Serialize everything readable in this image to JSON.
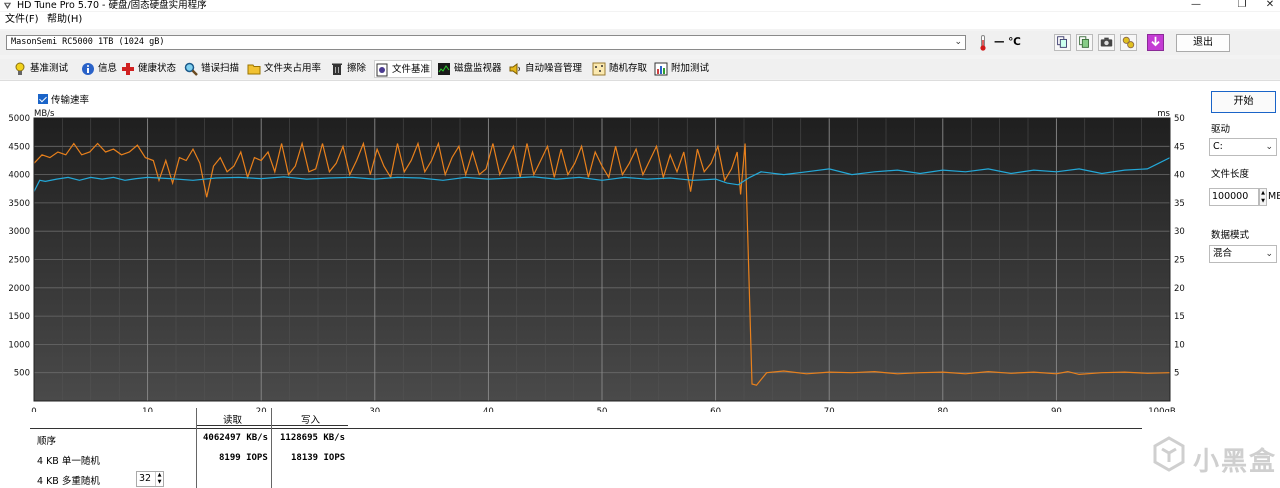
{
  "window": {
    "title": "HD Tune Pro 5.70 - 硬盘/固态硬盘实用程序"
  },
  "menu": [
    {
      "label": "文件(F)"
    },
    {
      "label": "帮助(H)"
    }
  ],
  "drive": {
    "name": "MasonSemi RC5000 1TB (1024 gB)",
    "temperature": "— ℃",
    "exit_label": "退出"
  },
  "tabs": [
    {
      "label": "基准测试",
      "icon": "bulb-icon"
    },
    {
      "label": "信息",
      "icon": "info-icon"
    },
    {
      "label": "健康状态",
      "icon": "health-cross-icon"
    },
    {
      "label": "错误扫描",
      "icon": "magnifier-icon"
    },
    {
      "label": "文件夹占用率",
      "icon": "folder-icon"
    },
    {
      "label": "擦除",
      "icon": "trash-icon"
    },
    {
      "label": "文件基准",
      "icon": "file-benchmark-icon"
    },
    {
      "label": "磁盘监视器",
      "icon": "monitor-icon"
    },
    {
      "label": "自动噪音管理",
      "icon": "speaker-icon"
    },
    {
      "label": "随机存取",
      "icon": "random-access-icon"
    },
    {
      "label": "附加测试",
      "icon": "extra-tests-icon"
    }
  ],
  "options": {
    "transfer_rate_label": "传输速率"
  },
  "side_panel": {
    "start_label": "开始",
    "drive_label": "驱动",
    "drive_value": "C:",
    "file_length_label": "文件长度",
    "file_length_value": "100000",
    "file_length_unit": "MB",
    "data_mode_label": "数据模式",
    "data_mode_value": "混合"
  },
  "results": {
    "col_read": "读取",
    "col_write": "写入",
    "rows": [
      {
        "label": "顺序",
        "read": "4062497 KB/s",
        "write": "1128695 KB/s"
      },
      {
        "label": "4 KB 单一随机",
        "read": "8199 IOPS",
        "write": "18139 IOPS"
      },
      {
        "label": "4 KB 多重随机",
        "read": "",
        "write": ""
      }
    ],
    "queue_depth": "32"
  },
  "watermark": {
    "text": "小黑盒"
  },
  "chart_data": {
    "type": "line",
    "ylabel": "MB/s",
    "y2label": "ms",
    "ylim": [
      0,
      5000
    ],
    "y2lim": [
      0,
      50
    ],
    "xlim": [
      0,
      100
    ],
    "x_unit": "gB",
    "y_ticks": [
      500,
      1000,
      1500,
      2000,
      2500,
      3000,
      3500,
      4000,
      4500,
      5000
    ],
    "y2_ticks": [
      5,
      10,
      15,
      20,
      25,
      30,
      35,
      40,
      45,
      50
    ],
    "x_ticks": [
      "0",
      "10",
      "20",
      "30",
      "40",
      "50",
      "60",
      "70",
      "80",
      "90",
      "100gB"
    ],
    "series": [
      {
        "color": "#e8801c",
        "x": [
          0,
          0.7,
          1.4,
          2.1,
          2.8,
          3.5,
          4.2,
          4.9,
          5.6,
          6.3,
          7,
          7.7,
          8.4,
          9.1,
          9.8,
          10.5,
          11,
          11.6,
          12.2,
          12.8,
          13.4,
          14,
          14.6,
          15.2,
          15.8,
          16.4,
          17,
          17.6,
          18.2,
          18.8,
          19.4,
          20,
          20.6,
          21.2,
          21.8,
          22.4,
          23,
          23.6,
          24.2,
          24.8,
          25.4,
          26,
          26.6,
          27.2,
          27.8,
          28.4,
          29,
          29.6,
          30.2,
          30.8,
          31.4,
          32,
          32.6,
          33.2,
          33.8,
          34.4,
          35,
          35.6,
          36.2,
          36.8,
          37.4,
          38,
          38.6,
          39.2,
          39.8,
          40.4,
          41,
          41.6,
          42.2,
          42.8,
          43.4,
          44,
          44.6,
          45.2,
          45.8,
          46.4,
          47,
          47.6,
          48.2,
          48.8,
          49.4,
          50,
          50.6,
          51.2,
          51.8,
          52.4,
          53,
          53.6,
          54.2,
          54.8,
          55.4,
          56,
          56.6,
          57.2,
          57.8,
          58.4,
          59,
          59.6,
          60.2,
          60.8,
          61.4,
          61.9,
          62.2,
          62.6,
          63.2,
          63.6,
          64.5,
          66,
          68,
          70,
          72,
          74,
          76,
          78,
          80,
          82,
          84,
          86,
          88,
          90,
          91,
          92,
          94,
          96,
          98,
          100
        ],
        "values": [
          4200,
          4350,
          4300,
          4400,
          4350,
          4550,
          4350,
          4400,
          4550,
          4400,
          4450,
          4350,
          4400,
          4520,
          4300,
          4250,
          3900,
          4250,
          3850,
          4300,
          4250,
          4450,
          4200,
          3600,
          4150,
          4300,
          4050,
          4150,
          4400,
          3950,
          4300,
          4250,
          4400,
          4050,
          4550,
          4000,
          4150,
          4550,
          4050,
          4100,
          4550,
          4050,
          4200,
          4500,
          4000,
          4250,
          4550,
          4000,
          4450,
          4150,
          3950,
          4550,
          4050,
          4250,
          4550,
          4050,
          4250,
          4550,
          4000,
          4300,
          4500,
          4000,
          4400,
          4000,
          4100,
          4550,
          4000,
          4250,
          4500,
          3950,
          4550,
          4000,
          4250,
          4500,
          3950,
          4450,
          4000,
          4200,
          4500,
          3950,
          4400,
          4150,
          3950,
          4500,
          4000,
          4200,
          4450,
          4000,
          4250,
          4500,
          3950,
          4350,
          4050,
          4400,
          3700,
          4450,
          4050,
          4200,
          4500,
          3900,
          4100,
          4400,
          3650,
          4550,
          300,
          280,
          500,
          530,
          480,
          510,
          500,
          520,
          480,
          500,
          510,
          480,
          520,
          490,
          510,
          480,
          520,
          470,
          500,
          510,
          490,
          500
        ]
      },
      {
        "color": "#23a8d8",
        "x": [
          0,
          0.5,
          1,
          2,
          3,
          4,
          5,
          6,
          7,
          8,
          9,
          10,
          12,
          14,
          16,
          18,
          20,
          22,
          24,
          26,
          28,
          30,
          32,
          34,
          36,
          38,
          40,
          42,
          44,
          46,
          48,
          50,
          52,
          54,
          56,
          58,
          60,
          61,
          62,
          62.6,
          63,
          64,
          66,
          68,
          70,
          72,
          74,
          76,
          78,
          80,
          82,
          84,
          86,
          88,
          90,
          92,
          94,
          96,
          98,
          99,
          100
        ],
        "values": [
          3700,
          3900,
          3880,
          3920,
          3950,
          3900,
          3950,
          3920,
          3950,
          3900,
          3930,
          3950,
          3930,
          3900,
          3940,
          3950,
          3930,
          3960,
          3920,
          3940,
          3950,
          3920,
          3950,
          3940,
          3900,
          3950,
          3920,
          3940,
          3960,
          3920,
          3950,
          3900,
          3950,
          3920,
          3940,
          3900,
          3920,
          3850,
          3820,
          3900,
          3950,
          4050,
          4000,
          4050,
          4100,
          4000,
          4050,
          4080,
          4020,
          4080,
          4050,
          4100,
          4020,
          4080,
          4050,
          4100,
          4020,
          4080,
          4100,
          4200,
          4300
        ]
      }
    ]
  }
}
